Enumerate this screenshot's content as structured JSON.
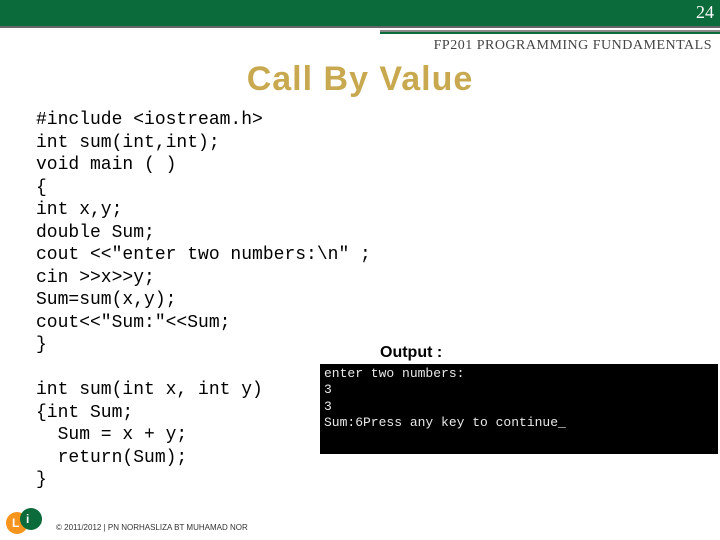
{
  "header": {
    "page_number": "24",
    "course": "FP201 PROGRAMMING FUNDAMENTALS",
    "title": "Call By Value"
  },
  "code": "#include <iostream.h>\nint sum(int,int);\nvoid main ( )\n{\nint x,y;\ndouble Sum;\ncout <<\"enter two numbers:\\n\" ;\ncin >>x>>y;\nSum=sum(x,y);\ncout<<\"Sum:\"<<Sum;\n}\n\nint sum(int x, int y)\n{int Sum;\n  Sum = x + y;\n  return(Sum);\n}",
  "output": {
    "label": "Output :",
    "console": "enter two numbers:\n3\n3\nSum:6Press any key to continue_"
  },
  "footer": {
    "copyright": "© 2011/2012 | PN NORHASLIZA BT MUHAMAD NOR"
  }
}
